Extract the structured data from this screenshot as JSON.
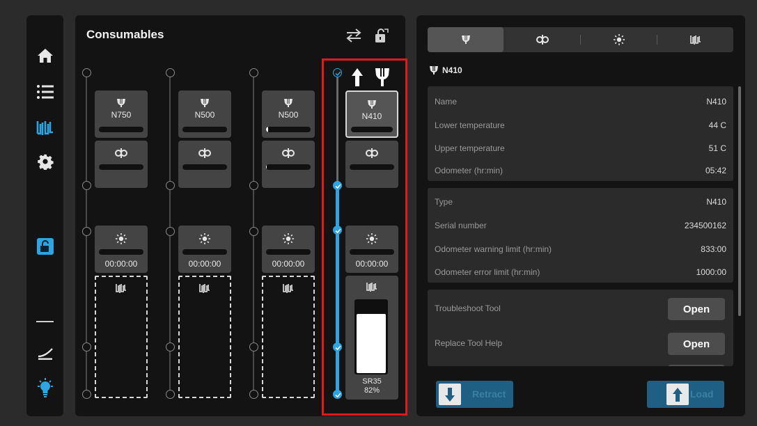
{
  "nav": {
    "icons": [
      "home-icon",
      "list-icon",
      "consumables-icon",
      "settings-icon",
      "unlock-icon",
      "divider",
      "slope-icon",
      "bulb-icon"
    ],
    "active_color": "#2da5e0"
  },
  "panel": {
    "title": "Consumables",
    "columns": [
      {
        "tool": "N750",
        "tool_fill": 0,
        "nozzle_fill": 0,
        "timer": "00:00:00"
      },
      {
        "tool": "N500",
        "tool_fill": 0,
        "nozzle_fill": 0,
        "timer": "00:00:00"
      },
      {
        "tool": "N500",
        "tool_fill": 0.05,
        "nozzle_fill": 0.02,
        "timer": "00:00:00"
      },
      {
        "tool": "N410",
        "tool_fill": 0,
        "nozzle_fill": 0,
        "timer": "00:00:00",
        "bottle_name": "SR35",
        "bottle_pct": "82%",
        "bottle_level": 0.82
      }
    ]
  },
  "details": {
    "tabs": [
      "tool-tab",
      "nozzle-tab",
      "light-tab",
      "material-tab"
    ],
    "title": "N410",
    "group1": [
      {
        "k": "Name",
        "v": "N410"
      },
      {
        "k": "Lower temperature",
        "v": "44 C"
      },
      {
        "k": "Upper temperature",
        "v": "51 C"
      },
      {
        "k": "Odometer (hr:min)",
        "v": "05:42"
      }
    ],
    "group2": [
      {
        "k": "Type",
        "v": "N410"
      },
      {
        "k": "Serial number",
        "v": "234500162"
      },
      {
        "k": "Odometer warning limit (hr:min)",
        "v": "833:00"
      },
      {
        "k": "Odometer error limit (hr:min)",
        "v": "1000:00"
      }
    ],
    "group3": [
      {
        "k": "Troubleshoot Tool",
        "btn": "Open"
      },
      {
        "k": "Replace Tool Help",
        "btn": "Open"
      }
    ],
    "retract_label": "Retract",
    "load_label": "Load"
  }
}
